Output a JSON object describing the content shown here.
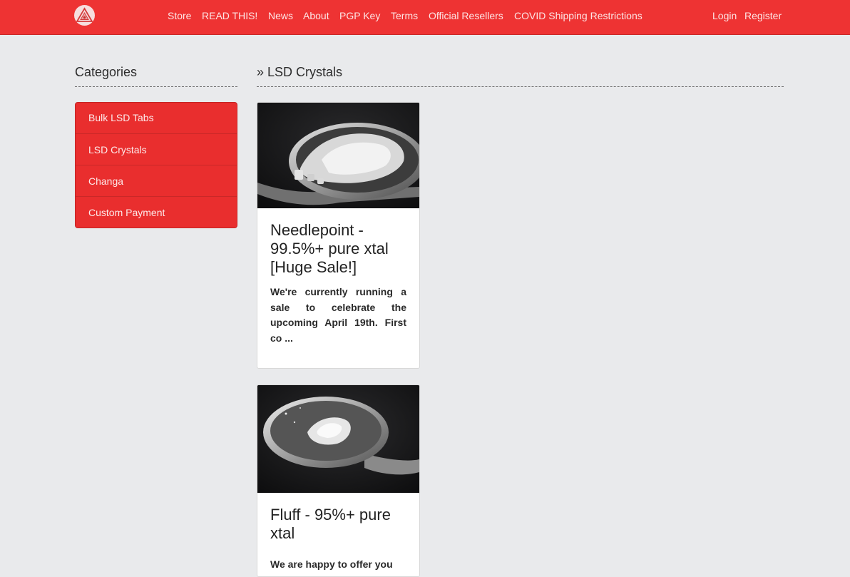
{
  "nav": {
    "links": [
      "Store",
      "READ THIS!",
      "News",
      "About",
      "PGP Key",
      "Terms",
      "Official Resellers",
      "COVID Shipping Restrictions"
    ],
    "login": "Login",
    "register": "Register"
  },
  "sidebar": {
    "heading": "Categories",
    "items": [
      "Bulk LSD Tabs",
      "LSD Crystals",
      "Changa",
      "Custom Payment"
    ]
  },
  "main": {
    "heading": "» LSD Crystals",
    "products": [
      {
        "title": "Needlepoint - 99.5%+ pure xtal [Huge Sale!]",
        "description": "We're currently running a sale to celebrate the upcoming April 19th. First co ..."
      },
      {
        "title": "Fluff - 95%+ pure xtal",
        "description": "We are happy to offer you"
      }
    ]
  },
  "colors": {
    "brand_red": "#ee3333",
    "page_bg": "#e9eaec"
  }
}
